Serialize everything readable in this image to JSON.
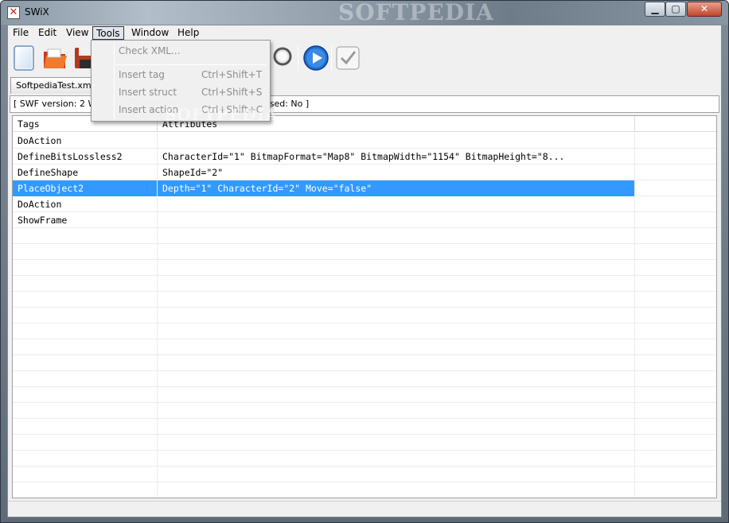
{
  "window": {
    "title": "SWiX",
    "watermark": "SOFTPEDIA"
  },
  "menubar": {
    "items": [
      "File",
      "Edit",
      "View",
      "Tools",
      "Window",
      "Help"
    ],
    "open_item": "Tools"
  },
  "tools_menu": {
    "items": [
      {
        "label": "Check XML...",
        "shortcut": ""
      },
      {
        "label": "Insert tag",
        "shortcut": "Ctrl+Shift+T"
      },
      {
        "label": "Insert struct",
        "shortcut": "Ctrl+Shift+S"
      },
      {
        "label": "Insert action",
        "shortcut": "Ctrl+Shift+C"
      }
    ],
    "enabled": false
  },
  "tab": {
    "label": "SoftpediaTest.xml"
  },
  "infobar": {
    "left": "[ SWF version: 2  W",
    "right": "ssed: No ]"
  },
  "grid": {
    "columns": [
      "Tags",
      "Attributes"
    ],
    "rows": [
      {
        "tag": "DoAction",
        "attrs": ""
      },
      {
        "tag": "DefineBitsLossless2",
        "attrs": "CharacterId=\"1\" BitmapFormat=\"Map8\" BitmapWidth=\"1154\" BitmapHeight=\"8..."
      },
      {
        "tag": "DefineShape",
        "attrs": "ShapeId=\"2\""
      },
      {
        "tag": "PlaceObject2",
        "attrs": "Depth=\"1\" CharacterId=\"2\" Move=\"false\"",
        "selected": true
      },
      {
        "tag": "DoAction",
        "attrs": ""
      },
      {
        "tag": "ShowFrame",
        "attrs": ""
      }
    ]
  },
  "toolbar_icons": [
    "new-document-icon",
    "open-folder-icon",
    "save-disk-icon",
    "search-magnifier-icon",
    "play-icon",
    "check-icon"
  ],
  "colors": {
    "selection": "#3399ff",
    "play": "#1f6fd1"
  }
}
